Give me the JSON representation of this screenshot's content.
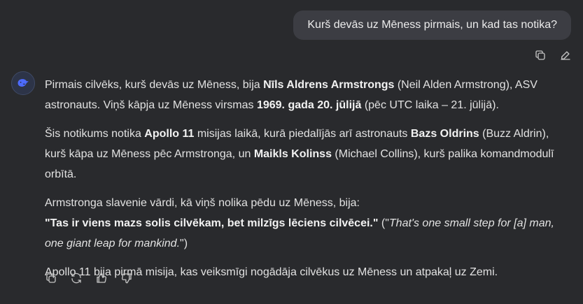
{
  "user_message": "Kurš devās uz Mēness pirmais, un kad tas notika?",
  "user_actions": {
    "copy_icon": "copy-icon",
    "edit_icon": "edit-icon"
  },
  "answer": {
    "p1": {
      "t1": "Pirmais cilvēks, kurš devās uz Mēness, bija ",
      "b1": "Nīls Aldrens Armstrongs",
      "t2": " (Neil Alden Armstrong), ASV astronauts. Viņš kāpja uz Mēness virsmas ",
      "b2": "1969. gada 20. jūlijā",
      "t3": " (pēc UTC laika – 21. jūlijā)."
    },
    "p2": {
      "t1": "Šis notikums notika ",
      "b1": "Apollo 11",
      "t2": " misijas laikā, kurā piedalījās arī astronauts ",
      "b2": "Bazs Oldrins",
      "t3": " (Buzz Aldrin), kurš kāpa uz Mēness pēc Armstronga, un ",
      "b3": "Maikls Kolinss",
      "t4": " (Michael Collins), kurš palika komandmodulī orbītā."
    },
    "p3": {
      "t1": "Armstronga slavenie vārdi, kā viņš nolika pēdu uz Mēness, bija:",
      "b1": "\"Tas ir viens mazs solis cilvēkam, bet milzīgs lēciens cilvēcei.\"",
      "t2": " (\"",
      "i1": "That's one small step for [a] man, one giant leap for mankind.",
      "t3": "\")"
    },
    "p4": {
      "t1": "Apollo 11 bija pirmā misija, kas veiksmīgi nogādāja cilvēkus uz Mēness un atpakaļ uz Zemi."
    }
  },
  "answer_actions": [
    "copy-icon",
    "regenerate-icon",
    "thumbs-up-icon",
    "thumbs-down-icon"
  ],
  "colors": {
    "background": "#292a2d",
    "user_bubble": "#3c3d43",
    "text": "#e2e2e2",
    "avatar_accent": "#4d6bfe"
  }
}
